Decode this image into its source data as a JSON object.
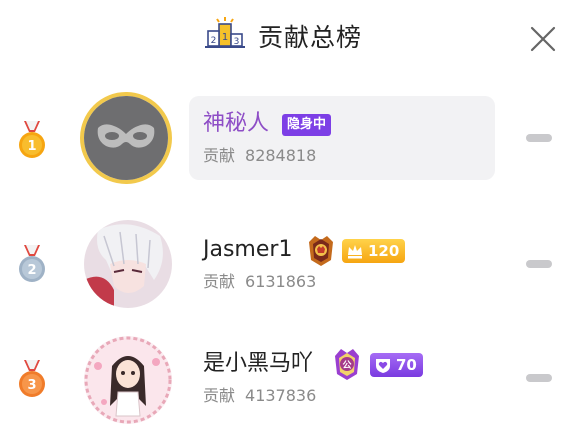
{
  "header": {
    "title": "贡献总榜",
    "podium_digits": [
      "2",
      "1",
      "3"
    ]
  },
  "colors": {
    "accent_purple": "#8e4ec6",
    "hidden_tag": "#7d3fe6",
    "gold": "#f6a511",
    "silver": "#9fb2c6",
    "bronze": "#f07c2a"
  },
  "ranking": [
    {
      "rank": "1",
      "medal": "gold-medal-icon",
      "name": "神秘人",
      "status_tag": "隐身中",
      "contribution_label": "贡献",
      "contribution_value": "8284818",
      "avatar": "mask-avatar"
    },
    {
      "rank": "2",
      "medal": "silver-medal-icon",
      "name": "Jasmer1",
      "badge_icon": "crown-shield-badge-icon",
      "level": "120",
      "contribution_label": "贡献",
      "contribution_value": "6131863",
      "avatar": "anime-boy-avatar"
    },
    {
      "rank": "3",
      "medal": "bronze-medal-icon",
      "name": "是小黑马吖",
      "badge_icon": "noble-shield-badge-icon",
      "badge_char": "公",
      "level": "70",
      "contribution_label": "贡献",
      "contribution_value": "4137836",
      "avatar": "anime-girl-avatar"
    }
  ]
}
